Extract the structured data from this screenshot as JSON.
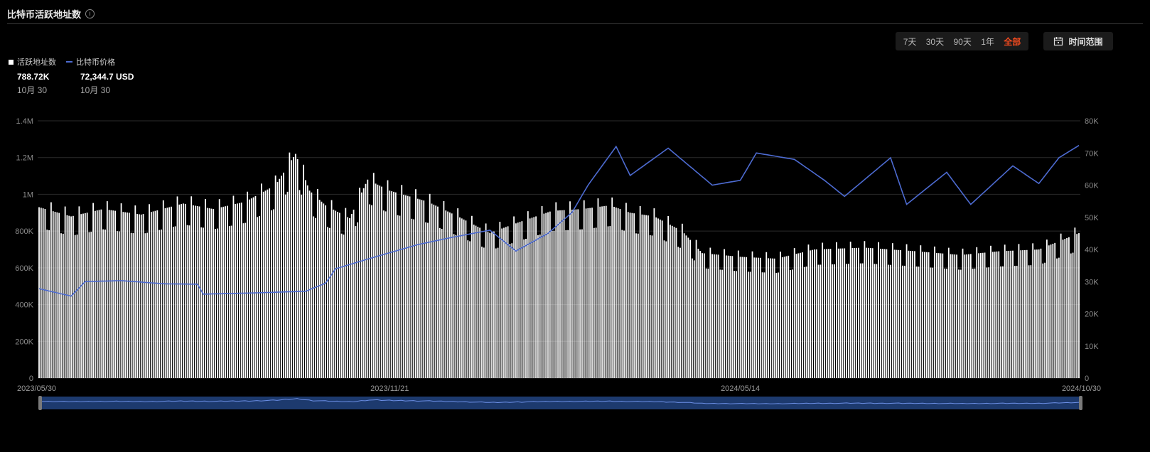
{
  "header": {
    "title": "比特币活跃地址数",
    "info_icon": "info-icon"
  },
  "range_buttons": [
    "7天",
    "30天",
    "90天",
    "1年",
    "全部"
  ],
  "range_active": "全部",
  "time_range": {
    "label": "时间范围",
    "icon": "calendar-icon"
  },
  "legend": [
    {
      "name": "活跃地址数",
      "color": "#ffffff"
    },
    {
      "name": "比特币价格",
      "color": "#4d6bd1"
    }
  ],
  "stats": [
    {
      "value": "788.72K",
      "date": "10月 30"
    },
    {
      "value": "72,344.7 USD",
      "date": "10月 30"
    }
  ],
  "colors": {
    "bar": "#ffffff",
    "price_line": "#4d6bd1",
    "accent": "#f04a1f",
    "grid": "#2a2a2a",
    "navigator": "#1d3a6e"
  },
  "chart_data": {
    "type": "bar",
    "x_start": "2023/05/30",
    "x_end": "2024/10/30",
    "x_tick_labels": [
      "2023/05/30",
      "2023/11/21",
      "2024/05/14",
      "2024/10/30"
    ],
    "y_left": {
      "ticks": [
        "0",
        "200K",
        "400K",
        "600K",
        "800K",
        "1M",
        "1.2M",
        "1.4M"
      ],
      "range": [
        0,
        1400000
      ]
    },
    "y_right": {
      "ticks": [
        "0",
        "10K",
        "20K",
        "30K",
        "40K",
        "50K",
        "60K",
        "70K",
        "80K"
      ],
      "range": [
        0,
        80000
      ]
    },
    "grid": true,
    "series": [
      {
        "name": "活跃地址数",
        "type": "bar",
        "keypoints": [
          [
            "2023/05/30",
            930000
          ],
          [
            "2023/06/15",
            880000
          ],
          [
            "2023/07/01",
            920000
          ],
          [
            "2023/07/20",
            890000
          ],
          [
            "2023/08/10",
            950000
          ],
          [
            "2023/08/25",
            920000
          ],
          [
            "2023/09/10",
            960000
          ],
          [
            "2023/09/25",
            1050000
          ],
          [
            "2023/10/05",
            1220000
          ],
          [
            "2023/10/12",
            1020000
          ],
          [
            "2023/10/20",
            940000
          ],
          [
            "2023/11/01",
            870000
          ],
          [
            "2023/11/10",
            1080000
          ],
          [
            "2023/11/21",
            1020000
          ],
          [
            "2023/12/10",
            960000
          ],
          [
            "2023/12/25",
            880000
          ],
          [
            "2024/01/10",
            790000
          ],
          [
            "2024/01/25",
            850000
          ],
          [
            "2024/02/10",
            910000
          ],
          [
            "2024/02/25",
            920000
          ],
          [
            "2024/03/10",
            940000
          ],
          [
            "2024/03/20",
            900000
          ],
          [
            "2024/04/01",
            880000
          ],
          [
            "2024/04/15",
            800000
          ],
          [
            "2024/04/25",
            680000
          ],
          [
            "2024/05/14",
            660000
          ],
          [
            "2024/06/01",
            650000
          ],
          [
            "2024/06/20",
            700000
          ],
          [
            "2024/07/15",
            710000
          ],
          [
            "2024/08/10",
            690000
          ],
          [
            "2024/09/01",
            670000
          ],
          [
            "2024/09/20",
            690000
          ],
          [
            "2024/10/10",
            700000
          ],
          [
            "2024/10/30",
            788720
          ]
        ]
      },
      {
        "name": "比特币价格",
        "type": "line",
        "keypoints": [
          [
            "2023/05/30",
            27800
          ],
          [
            "2023/06/15",
            25500
          ],
          [
            "2023/06/22",
            30000
          ],
          [
            "2023/07/10",
            30300
          ],
          [
            "2023/08/01",
            29300
          ],
          [
            "2023/08/17",
            29200
          ],
          [
            "2023/08/20",
            26100
          ],
          [
            "2023/09/15",
            26500
          ],
          [
            "2023/10/10",
            27000
          ],
          [
            "2023/10/20",
            29500
          ],
          [
            "2023/10/25",
            34000
          ],
          [
            "2023/11/10",
            37000
          ],
          [
            "2023/12/05",
            41500
          ],
          [
            "2023/12/20",
            43500
          ],
          [
            "2024/01/10",
            46000
          ],
          [
            "2024/01/23",
            39500
          ],
          [
            "2024/02/08",
            45000
          ],
          [
            "2024/02/20",
            51500
          ],
          [
            "2024/02/28",
            60000
          ],
          [
            "2024/03/13",
            72000
          ],
          [
            "2024/03/20",
            63000
          ],
          [
            "2024/04/08",
            71500
          ],
          [
            "2024/04/30",
            60000
          ],
          [
            "2024/05/14",
            61500
          ],
          [
            "2024/05/22",
            70000
          ],
          [
            "2024/06/10",
            68000
          ],
          [
            "2024/06/25",
            61500
          ],
          [
            "2024/07/05",
            56500
          ],
          [
            "2024/07/28",
            68500
          ],
          [
            "2024/08/05",
            54000
          ],
          [
            "2024/08/25",
            64000
          ],
          [
            "2024/09/06",
            54000
          ],
          [
            "2024/09/27",
            66000
          ],
          [
            "2024/10/10",
            60500
          ],
          [
            "2024/10/20",
            68500
          ],
          [
            "2024/10/30",
            72344.7
          ]
        ]
      }
    ]
  }
}
